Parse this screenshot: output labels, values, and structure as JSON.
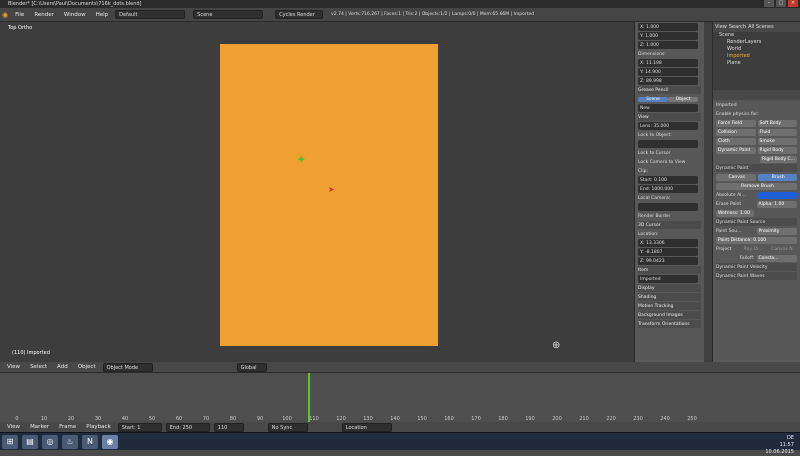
{
  "window_title": "Blender* [C:\\Users\\Paul\\Documents\\716k_dots.blend]",
  "menus": [
    "File",
    "Render",
    "Window",
    "Help"
  ],
  "layout": "Default",
  "scene": "Scene",
  "engine": "Cycles Render",
  "stats": "v2.74 | Verts:716,267 | Faces:1 | Tris:2 | Objects:1/2 | Lamps:0/0 | Mem:65.66M | Imported",
  "viewport": {
    "view_label": "Top Ortho",
    "object_label": "(110) Imported"
  },
  "properties": {
    "x": "X: 1.000",
    "y": "Y: 1.000",
    "z": "Z: 1.000",
    "dimensions_label": "Dimensions:",
    "dx": "X: 11.198",
    "dy": "Y: 14.900",
    "dz": "Z: 89.998",
    "grease_pencil": "Grease Pencil",
    "gp_scene": "Scene",
    "gp_object": "Object",
    "gp_new": "New",
    "view": "View",
    "lens": "Lens: 35.000",
    "lock_to_object": "Lock to Object:",
    "lock_to_cursor": "Lock to Cursor",
    "lock_camera_to_view": "Lock Camera to View",
    "clip": "Clip:",
    "clip_start": "Start: 0.100",
    "clip_end": "End: 1000.000",
    "local_camera": "Local Camera:",
    "render_border": "Render Border",
    "cursor_3d": "3D Cursor",
    "location": "Location:",
    "cx": "X: 13.3306",
    "cy": "Y: -8.1807",
    "cz": "Z: 99.0423",
    "item": "Item",
    "item_name": "Imported",
    "display": "Display",
    "shading": "Shading",
    "motion_tracking": "Motion Tracking",
    "background_images": "Background Images",
    "transform_orientations": "Transform Orientations"
  },
  "outliner": {
    "tabs": [
      "View",
      "Search",
      "All Scenes"
    ],
    "items": [
      "Scene",
      "RenderLayers",
      "World",
      "Imported",
      "Plane"
    ]
  },
  "physics": {
    "object_name": "Imported",
    "enable_label": "Enable physics for:",
    "buttons": [
      [
        "Force Field",
        "Soft Body"
      ],
      [
        "Collision",
        "Fluid"
      ],
      [
        "Cloth",
        "Smoke"
      ],
      [
        "Dynamic Paint",
        "Rigid Body"
      ],
      [
        "",
        "Rigid Body C..."
      ]
    ],
    "dynamic_paint": "Dynamic Paint",
    "canvas": "Canvas",
    "brush": "Brush",
    "remove_brush": "Remove Brush",
    "absolute_alpha": "Absolute Al...",
    "erase_paint": "Erase Paint",
    "alpha": "Alpha: 1.00",
    "wetness": "Wetness: 1.00",
    "source": "Dynamic Paint Source",
    "paint_source": "Paint Sou...",
    "proximity": "Proximity",
    "paint_distance": "Paint Distance: 0.100",
    "project": "Project",
    "ray_dir": "Ray Di...",
    "canvas_n": "Canvas N...",
    "falloff": "Falloff:",
    "constant": "Consta...",
    "velocity": "Dynamic Paint Velocity",
    "waves": "Dynamic Paint Waves"
  },
  "viewport_header": {
    "items": [
      "View",
      "Select",
      "Add",
      "Object"
    ],
    "mode": "Object Mode",
    "orientation": "Global"
  },
  "timeline": {
    "ticks": [
      "0",
      "10",
      "20",
      "30",
      "40",
      "50",
      "60",
      "70",
      "80",
      "90",
      "100",
      "110",
      "120",
      "130",
      "140",
      "150",
      "160",
      "170",
      "180",
      "190",
      "200",
      "210",
      "220",
      "230",
      "240",
      "250"
    ],
    "menus": [
      "View",
      "Marker",
      "Frame",
      "Playback"
    ],
    "start": "Start: 1",
    "end": "End: 250",
    "current": "110",
    "sync": "No Sync",
    "keying": "Location",
    "playhead_frame": 110
  },
  "taskbar": {
    "lang": "DE",
    "time": "11:57",
    "date": "10.06.2015"
  }
}
